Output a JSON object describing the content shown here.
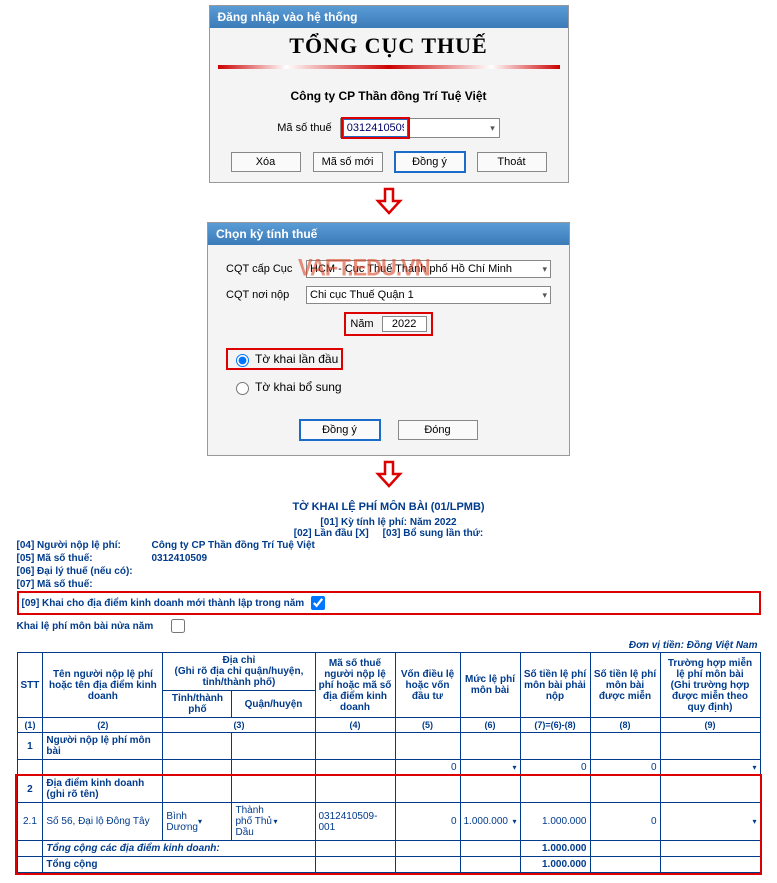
{
  "win1": {
    "title": "Đăng nhập vào hệ thống",
    "heading": "TỔNG CỤC THUẾ",
    "company": "Công ty CP Thần đồng Trí Tuệ Việt",
    "mst_label": "Mã số thuế",
    "mst_value": "0312410509",
    "buttons": {
      "xoa": "Xóa",
      "msm": "Mã số mới",
      "dy": "Đồng ý",
      "thoat": "Thoát"
    }
  },
  "win2": {
    "title": "Chọn kỳ tính thuế",
    "cqt_cap_label": "CQT cấp Cục",
    "cqt_cap_value": "HCM - Cục Thuế Thành phố Hồ Chí Minh",
    "cqt_noi_label": "CQT nơi nộp",
    "cqt_noi_value": "Chi cục Thuế Quận 1",
    "year_label": "Năm",
    "year_value": "2022",
    "radio1": "Tờ khai lần đầu",
    "radio2": "Tờ khai bổ sung",
    "dy": "Đồng ý",
    "dong": "Đóng",
    "watermark": "VAFT.EDU.VN"
  },
  "form": {
    "title": "TỜ KHAI LỆ PHÍ MÔN BÀI (01/LPMB)",
    "meta1": "[01]  Kỳ tính lệ phí: Năm 2022",
    "meta2a": "[02] Lần đầu [X]",
    "meta2b": "[03] Bổ sung lần thứ:",
    "rows": {
      "r04_l": "[04]  Người nộp lệ phí:",
      "r04_v": "Công ty CP Thần đồng Trí Tuệ Việt",
      "r05_l": "[05]  Mã số thuế:",
      "r05_v": "0312410509",
      "r06_l": "[06]  Đại lý thuế (nếu có):",
      "r07_l": "[07]  Mã số thuế:",
      "r09_l": "[09]  Khai cho địa điểm kinh doanh mới thành lập trong năm",
      "r_khai": "Khai lệ phí môn bài nửa năm"
    },
    "unit": "Đơn vị tiền: Đồng Việt Nam",
    "headers": {
      "stt": "STT",
      "ten": "Tên người nộp lệ phí hoặc tên địa điểm kinh doanh",
      "dc_top": "Địa chỉ\n(Ghi rõ địa chỉ quận/huyện, tỉnh/thành phố)",
      "dc_tinh": "Tỉnh/thành phố",
      "dc_huyen": "Quận/huyện",
      "mst": "Mã số thuế người nộp lệ phí hoặc mã số địa điểm kinh doanh",
      "von": "Vốn điều lệ hoặc vốn đầu tư",
      "muc": "Mức lệ phí môn bài",
      "phainop": "Số tiền lệ phí môn bài phải nộp",
      "duocmien": "Số tiền lệ phí môn bài được miễn",
      "truonghop": "Trường hợp miễn lệ phí môn bài\n(Ghi trường hợp được miễn theo quy định)"
    },
    "colnums": [
      "(1)",
      "(2)",
      "(3)",
      "(4)",
      "(5)",
      "(6)",
      "(7)=(6)-(8)",
      "(8)",
      "(9)"
    ],
    "data_rows": {
      "r1_stt": "1",
      "r1_name": "Người nộp lệ phí môn bài",
      "r1_von": "0",
      "r1_phainop": "0",
      "r1_mien": "0",
      "r2_stt": "2",
      "r2_name": "Địa điểm kinh doanh\n(ghi rõ tên)",
      "r21_stt": "2.1",
      "r21_name": "Số 56, Đại lộ Đông Tây",
      "r21_tinh": "Bình Dương",
      "r21_huyen": "Thành phố Thủ Dầu",
      "r21_mst": "0312410509-001",
      "r21_von": "0",
      "r21_muc": "1.000.000",
      "r21_phainop": "1.000.000",
      "r21_mien": "0",
      "tc_dd": "Tổng cộng các địa điểm kinh doanh:",
      "tc_dd_val": "1.000.000",
      "tc": "Tổng cộng",
      "tc_val": "1.000.000"
    }
  }
}
